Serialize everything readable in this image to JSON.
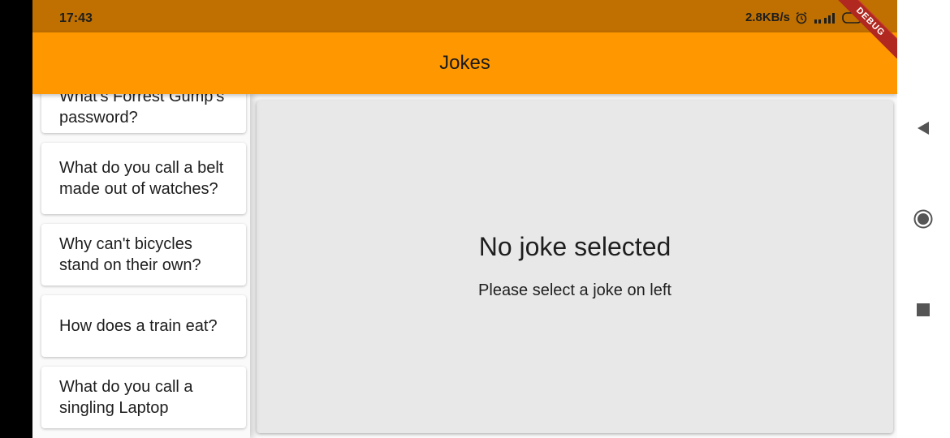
{
  "status_bar": {
    "time": "17:43",
    "network_speed": "2.8KB/s",
    "icons": [
      "alarm-icon",
      "signal-icon",
      "battery-icon"
    ]
  },
  "app_bar": {
    "title": "Jokes",
    "background_color": "#ff9800",
    "debug_banner": "DEBUG"
  },
  "jokes": [
    {
      "question": "What's Forrest Gump's password?",
      "height": 64
    },
    {
      "question": "What do you call a belt made out of watches?",
      "height": 88
    },
    {
      "question": "Why can't bicycles stand on their own?",
      "height": 76
    },
    {
      "question": "How does a train eat?",
      "height": 76
    },
    {
      "question": "What do you call a singling Laptop",
      "height": 76
    }
  ],
  "detail": {
    "title": "No joke selected",
    "subtitle": "Please select a joke on left"
  },
  "nav": {
    "icons": [
      "back-icon",
      "home-icon",
      "recents-icon"
    ]
  }
}
